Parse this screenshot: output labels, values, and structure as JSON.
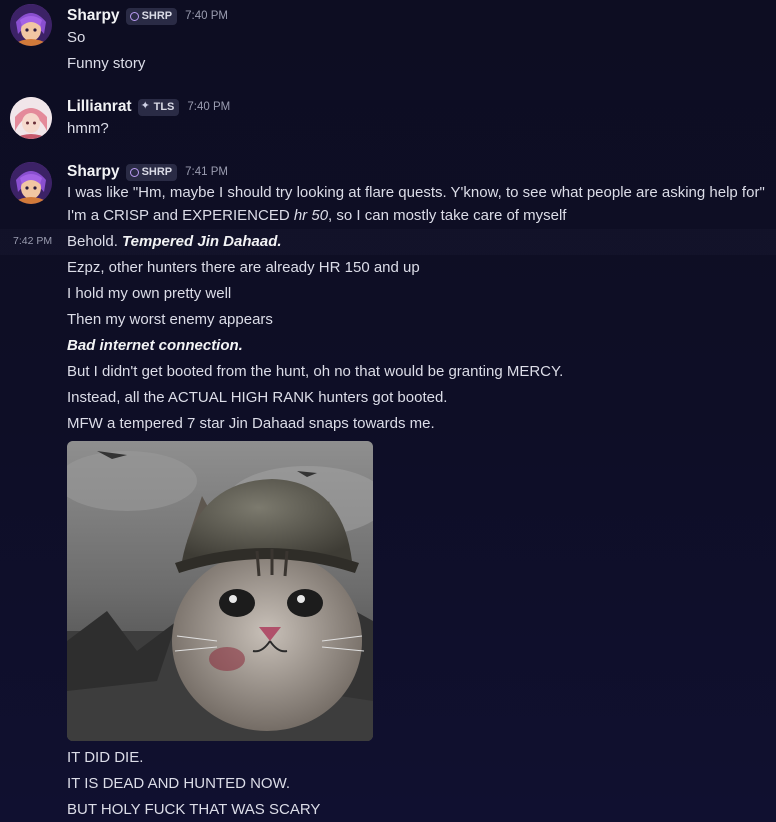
{
  "messages": [
    {
      "author": "Sharpy",
      "tag": "SHRP",
      "time": "7:40 PM",
      "lines": [
        "So",
        "Funny story"
      ]
    },
    {
      "author": "Lillianrat",
      "tag": "TLS",
      "time": "7:40 PM",
      "lines": [
        "hmm?"
      ]
    },
    {
      "author": "Sharpy",
      "tag": "SHRP",
      "time": "7:41 PM",
      "lines": [
        "I was like \"Hm, maybe I should try looking at flare quests. Y'know, to see what people are asking help for\"",
        "I'm a CRISP and EXPERIENCED ",
        "hr 50",
        ", so I can mostly take care of myself",
        "Behold. ",
        "Tempered Jin Dahaad.",
        "Ezpz, other hunters there are already HR 150 and up",
        "I hold my own pretty well",
        "Then my worst enemy appears",
        "Bad internet connection.",
        "But I didn't get booted from the hunt, oh no that would be granting MERCY.",
        "Instead, all the ACTUAL HIGH RANK hunters got booted.",
        "MFW a tempered 7 star Jin Dahaad snaps towards me.",
        "IT DID DIE.",
        "IT IS DEAD AND HUNTED NOW.",
        "BUT HOLY FUCK THAT WAS SCARY"
      ],
      "hover_time": "7:42 PM"
    }
  ],
  "colors": {
    "background": "#0d0d22",
    "username": "#f2f3f5",
    "text": "#dcdde8",
    "timestamp": "#9a9cb0",
    "tag_bg": "#2a2b45"
  }
}
